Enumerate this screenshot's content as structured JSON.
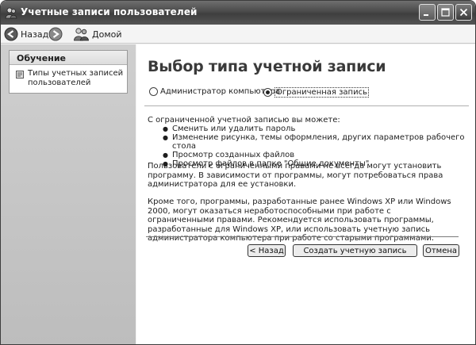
{
  "window": {
    "title": "Учетные записи пользователей"
  },
  "toolbar": {
    "back_label": "Назад",
    "home_label": "Домой"
  },
  "taskpane": {
    "section_title": "Обучение",
    "link_label": "Типы учетных записей пользователей"
  },
  "main": {
    "heading": "Выбор типа учетной записи",
    "radio_admin": "Администратор компьютера",
    "radio_limited": "Ограниченная запись",
    "selected_option": "Ограниченная запись",
    "intro": "С ограниченной учетной записью вы можете:",
    "bullets": [
      "Сменить или удалить пароль",
      "Изменение рисунка, темы оформления, других параметров рабочего стола",
      "Просмотр созданных файлов",
      "Просмотр файлов в папке \"Общие документы\""
    ],
    "paragraph1": "Пользователи с ограниченными правами не всегда могут установить программу. В зависимости от программы, могут потребоваться права администратора для ее установки.",
    "paragraph2": "Кроме того, программы, разработанные ранее Windows XP или Windows 2000, могут оказаться неработоспособными при работе с ограниченными правами. Рекомендуется использовать программы, разработанные для Windows XP, или использовать учетную запись администратора компьютера при работе со старыми программами."
  },
  "buttons": {
    "back": "< Назад",
    "create": "Создать учетную запись",
    "cancel": "Отмена"
  }
}
